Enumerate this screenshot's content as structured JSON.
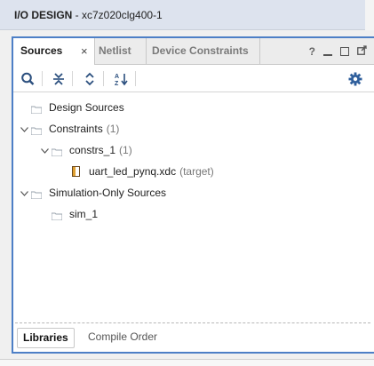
{
  "window": {
    "title_bold": "I/O DESIGN",
    "title_rest": " - xc7z020clg400-1"
  },
  "tabs": [
    {
      "label": "Sources",
      "active": true
    },
    {
      "label": "Netlist",
      "active": false
    },
    {
      "label": "Device Constraints",
      "active": false
    }
  ],
  "tab_actions": {
    "help": "?",
    "close_symbol": "×"
  },
  "tree": {
    "design_sources": "Design Sources",
    "constraints": {
      "label": "Constraints",
      "count": "(1)"
    },
    "constrs_1": {
      "label": "constrs_1",
      "count": "(1)"
    },
    "xdc_file": {
      "label": "uart_led_pynq.xdc",
      "tag": "(target)"
    },
    "simulation_sources": "Simulation-Only Sources",
    "sim_1": "sim_1"
  },
  "bottom_tabs": {
    "libraries": "Libraries",
    "compile_order": "Compile Order"
  },
  "colors": {
    "accent": "#4d7fc6",
    "folder": "#9aa3ad",
    "gear": "#2f5f9c"
  }
}
